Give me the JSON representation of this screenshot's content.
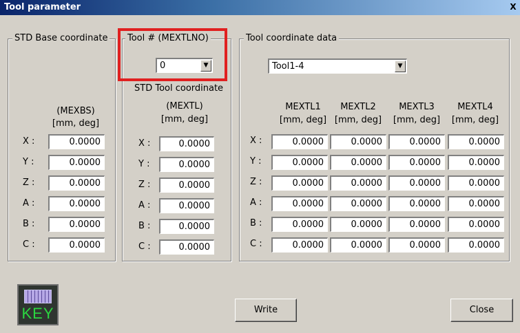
{
  "window": {
    "title": "Tool parameter",
    "close_glyph": "X"
  },
  "base": {
    "legend": "STD Base coordinate",
    "header1": "(MEXBS)",
    "header2": "[mm, deg]",
    "rows": [
      {
        "label": "X :",
        "value": "0.0000"
      },
      {
        "label": "Y :",
        "value": "0.0000"
      },
      {
        "label": "Z :",
        "value": "0.0000"
      },
      {
        "label": "A :",
        "value": "0.0000"
      },
      {
        "label": "B :",
        "value": "0.0000"
      },
      {
        "label": "C :",
        "value": "0.0000"
      }
    ]
  },
  "toolno": {
    "legend": "Tool # (MEXTLNO)",
    "value": "0"
  },
  "stdtool": {
    "legend": "STD Tool coordinate",
    "header1": "(MEXTL)",
    "header2": "[mm, deg]",
    "rows": [
      {
        "label": "X :",
        "value": "0.0000"
      },
      {
        "label": "Y :",
        "value": "0.0000"
      },
      {
        "label": "Z :",
        "value": "0.0000"
      },
      {
        "label": "A :",
        "value": "0.0000"
      },
      {
        "label": "B :",
        "value": "0.0000"
      },
      {
        "label": "C :",
        "value": "0.0000"
      }
    ]
  },
  "tooldata": {
    "legend": "Tool coordinate data",
    "select_value": "Tool1-4",
    "columns": [
      {
        "name": "MEXTL1",
        "unit": "[mm, deg]"
      },
      {
        "name": "MEXTL2",
        "unit": "[mm, deg]"
      },
      {
        "name": "MEXTL3",
        "unit": "[mm, deg]"
      },
      {
        "name": "MEXTL4",
        "unit": "[mm, deg]"
      }
    ],
    "row_labels": [
      "X :",
      "Y :",
      "Z :",
      "A :",
      "B :",
      "C :"
    ],
    "values": [
      [
        "0.0000",
        "0.0000",
        "0.0000",
        "0.0000"
      ],
      [
        "0.0000",
        "0.0000",
        "0.0000",
        "0.0000"
      ],
      [
        "0.0000",
        "0.0000",
        "0.0000",
        "0.0000"
      ],
      [
        "0.0000",
        "0.0000",
        "0.0000",
        "0.0000"
      ],
      [
        "0.0000",
        "0.0000",
        "0.0000",
        "0.0000"
      ],
      [
        "0.0000",
        "0.0000",
        "0.0000",
        "0.0000"
      ]
    ]
  },
  "buttons": {
    "key": "KEY",
    "write": "Write",
    "close": "Close"
  },
  "icons": {
    "keyboard": "keyboard-key-icon",
    "dropdown": "chevron-down-icon"
  },
  "colors": {
    "highlight": "#e02020",
    "key_text": "#2bd640"
  }
}
